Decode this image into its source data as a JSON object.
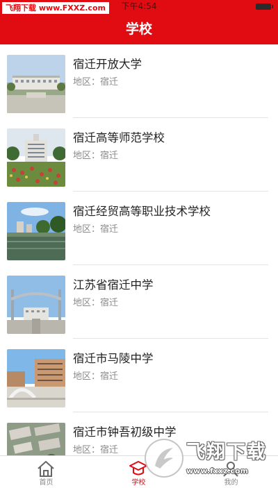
{
  "status_bar": {
    "watermark": "飞翔下载 www.FXXZ.com",
    "time": "下午4:54"
  },
  "header": {
    "title": "学校"
  },
  "schools": [
    {
      "name": "宿迁开放大学",
      "region": "地区：宿迁",
      "thumb": "campus-building-photo"
    },
    {
      "name": "宿迁高等师范学校",
      "region": "地区：宿迁",
      "thumb": "campus-garden-photo"
    },
    {
      "name": "宿迁经贸高等职业技术学校",
      "region": "地区：宿迁",
      "thumb": "campus-lake-photo"
    },
    {
      "name": "江苏省宿迁中学",
      "region": "地区：宿迁",
      "thumb": "school-gate-photo"
    },
    {
      "name": "宿迁市马陵中学",
      "region": "地区：宿迁",
      "thumb": "school-plaza-photo"
    },
    {
      "name": "宿迁市钟吾初级中学",
      "region": "地区：宿迁",
      "thumb": "aerial-campus-photo"
    }
  ],
  "tabs": [
    {
      "label": "首页",
      "icon": "home-icon",
      "active": false
    },
    {
      "label": "学校",
      "icon": "graduation-cap-icon",
      "active": true
    },
    {
      "label": "我的",
      "icon": "user-icon",
      "active": false
    }
  ],
  "watermark": {
    "text": "飞翔下载",
    "url": "www.fxxz.com"
  },
  "colors": {
    "brand_red": "#e10b12"
  }
}
